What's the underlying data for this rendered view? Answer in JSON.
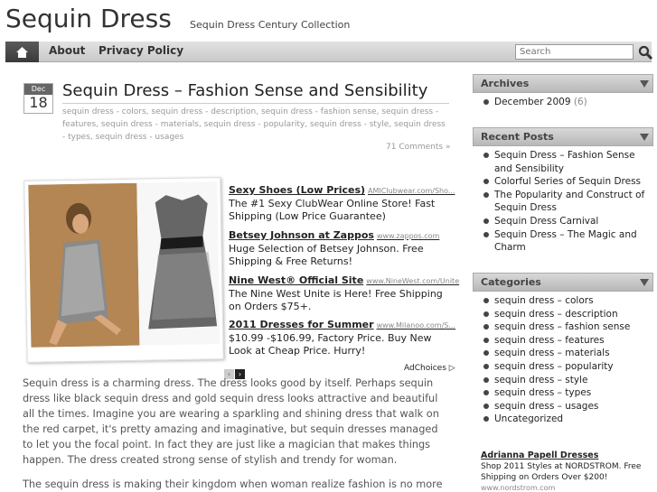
{
  "header": {
    "site_title": "Sequin Dress",
    "site_desc": "Sequin Dress Century Collection"
  },
  "nav": {
    "home_icon": "home-icon",
    "items": [
      {
        "label": "About"
      },
      {
        "label": "Privacy Policy"
      }
    ],
    "search_placeholder": "Search"
  },
  "post": {
    "month": "Dec",
    "day": "18",
    "title": "Sequin Dress – Fashion Sense and Sensibility",
    "tags_line1": "sequin dress - colors, sequin dress - description, sequin dress - fashion sense, sequin dress -",
    "tags_line2": "features, sequin dress - materials, sequin dress - popularity, sequin dress - style, sequin dress - types, sequin dress - usages",
    "comments": "71 Comments »",
    "para1": "Sequin dress is a charming dress. The dress looks good by itself. Perhaps sequin dress like black sequin dress and gold sequin dress looks attractive and beautiful all the times. Imagine you are wearing a sparkling and shining dress that walk on the red carpet, it's pretty amazing and imaginative, but sequin dresses managed to let you the focal point. In fact they are just like a magician that makes things happen. The dress created strong sense of stylish and trendy for woman.",
    "para2": "The sequin dress is making their kingdom when woman realize fashion is no more black"
  },
  "ads": [
    {
      "title": "Sexy Shoes (Low Prices)",
      "url": "AMIClubwear.com/Sho...",
      "text": "The #1 Sexy ClubWear Online Store! Fast Shipping (Low Price Guarantee)"
    },
    {
      "title": "Betsey Johnson at Zappos",
      "url": "www.zappos.com",
      "text": "Huge Selection of Betsey Johnson. Free Shipping & Free Returns!"
    },
    {
      "title": "Nine West® Official Site",
      "url": "www.NineWest.com/Unite",
      "text": "The Nine West Unite is Here! Free Shipping on Orders $75+."
    },
    {
      "title": "2011 Dresses for Summer",
      "url": "www.Milanoo.com/S...",
      "text": "$10.99 -$106.99, Factory Price. Buy New Look at Cheap Price. Hurry!"
    }
  ],
  "ad_controls": {
    "prev": "‹",
    "next": "›",
    "adchoices": "AdChoices ▷"
  },
  "sidebar": {
    "archives_title": "Archives",
    "archives": [
      {
        "label": "December 2009",
        "count": "(6)"
      }
    ],
    "recent_title": "Recent Posts",
    "recent": [
      "Sequin Dress – Fashion Sense and Sensibility",
      "Colorful Series of Sequin Dress",
      "The Popularity and Construct of Sequin Dress",
      "Sequin Dress Carnival",
      "Sequin Dress – The Magic and Charm"
    ],
    "categories_title": "Categories",
    "categories": [
      "sequin dress – colors",
      "sequin dress – description",
      "sequin dress – fashion sense",
      "sequin dress – features",
      "sequin dress – materials",
      "sequin dress – popularity",
      "sequin dress – style",
      "sequin dress – types",
      "sequin dress – usages",
      "Uncategorized"
    ],
    "side_ad": {
      "title": "Adrianna Papell Dresses",
      "text": "Shop 2011 Styles at NORDSTROM. Free Shipping on Orders Over $200!",
      "url": "www.nordstrom.com"
    }
  }
}
